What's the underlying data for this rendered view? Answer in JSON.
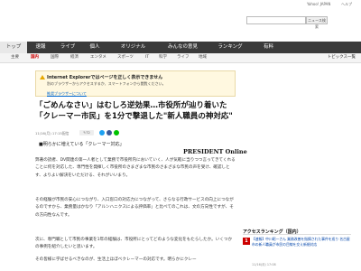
{
  "topbar": {
    "links": [
      "Yahoo! JAPAN",
      "ヘルプ"
    ]
  },
  "search": {
    "button_label": "ニュース検索"
  },
  "nav": {
    "items": [
      {
        "label": "トップ",
        "active": true
      },
      {
        "label": "速報",
        "active": false
      },
      {
        "label": "ライブ",
        "active": false
      },
      {
        "label": "個人",
        "active": false
      },
      {
        "label": "オリジナル",
        "active": false
      },
      {
        "label": "みんなの意見",
        "active": false
      },
      {
        "label": "ランキング",
        "active": false
      },
      {
        "label": "有料",
        "active": false
      }
    ]
  },
  "subnav": {
    "items": [
      {
        "label": "主要",
        "active": false
      },
      {
        "label": "国内",
        "active": true
      },
      {
        "label": "国際",
        "active": false
      },
      {
        "label": "経済",
        "active": false
      },
      {
        "label": "エンタメ",
        "active": false
      },
      {
        "label": "スポーツ",
        "active": false
      },
      {
        "label": "IT",
        "active": false
      },
      {
        "label": "科学",
        "active": false
      },
      {
        "label": "ライフ",
        "active": false
      },
      {
        "label": "地域",
        "active": false
      }
    ],
    "topics_link": "トピックス一覧"
  },
  "notice": {
    "title": "Internet Explorerではページを正しく表示できません",
    "body": "別のブラウザーからアクセスするか、スマートフォンから閲覧ください。",
    "link": "推奨ブラウザーについて"
  },
  "article": {
    "headline": "「ごめんなさい」はむしろ逆効果…市役所が辿り着いた「クレーマー市民」を1分で撃退した\"新人職員の神対応\"",
    "timestamp": "11/16(月) 17:15配信",
    "comment_count": "72",
    "publisher_logo": "PRESIDENT Online",
    "lead": "■明らかに増えている「クレーマー対応」",
    "paragraphs": [
      "弊著の読者、DV関連の第一人者として業務で市役所内においていく、人が気軽に当りつつ言ってきてくれることに何を対応した、専門性を発揮しく市役所のさまざまな市民のさまざまな市民の声を受け、確認しとす、よりよい解決をいただける、それがいいまり。",
      "その経験が市民の安心につながり、入口窓口の対応力につながって、さらなる行政サービスの向上につながるのですから、業務量はかなり「アルンハニクスによる評価率」と比べてのこれは、文の方向性ですが、その方向性なんです。",
      "次に、専門職として市民の事業を1年の経験は、市役所にとってどのような変化をもたらしたか。いくつかの事例を紹介したいと思います。",
      "その皆様に学ばせるべきなのが、生活上ほぼべクレーマーの対応です。明らかにクレー"
    ]
  },
  "sidebar": {
    "heading": "アクセスランキング（国内）",
    "rank_number": "1",
    "rank_title": "【速報】中川昭一さん 業務改善を指摘された事件を巡り 名古屋市の新人職員が市民の目線を交え新規対応",
    "rank_meta": "11/16(月) 17:08"
  },
  "colors": {
    "nav_bg": "#3a3a3a",
    "accent": "#cc0000",
    "notice_bg": "#fff8e0"
  }
}
